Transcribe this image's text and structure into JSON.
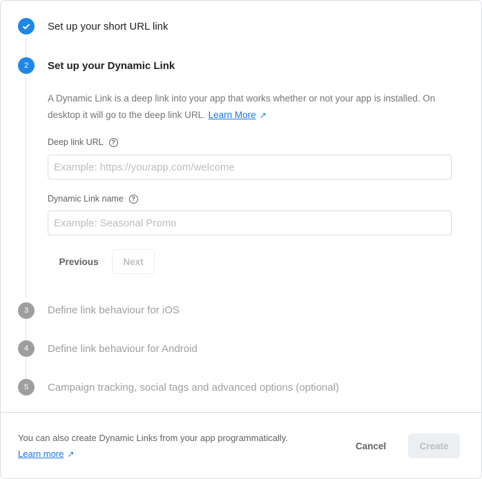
{
  "steps": [
    {
      "number": "1",
      "title": "Set up your short URL link",
      "state": "complete"
    },
    {
      "number": "2",
      "title": "Set up your Dynamic Link",
      "state": "active"
    },
    {
      "number": "3",
      "title": "Define link behaviour for iOS",
      "state": "disabled"
    },
    {
      "number": "4",
      "title": "Define link behaviour for Android",
      "state": "disabled"
    },
    {
      "number": "5",
      "title": "Campaign tracking, social tags and advanced options (optional)",
      "state": "disabled"
    }
  ],
  "description": "A Dynamic Link is a deep link into your app that works whether or not your app is installed. On desktop it will go to the deep link URL.",
  "learn_more": "Learn More",
  "deep_link": {
    "label": "Deep link URL",
    "value": "",
    "placeholder": "Example: https://yourapp.com/welcome"
  },
  "link_name": {
    "label": "Dynamic Link name",
    "value": "",
    "placeholder": "Example: Seasonal Promo"
  },
  "buttons": {
    "previous": "Previous",
    "next": "Next",
    "cancel": "Cancel",
    "create": "Create"
  },
  "footer": {
    "text": "You can also create Dynamic Links from your app programmatically.",
    "learn_more": "Learn more"
  },
  "colors": {
    "accent": "#1e88e5",
    "disabled_step": "#9e9e9e"
  }
}
